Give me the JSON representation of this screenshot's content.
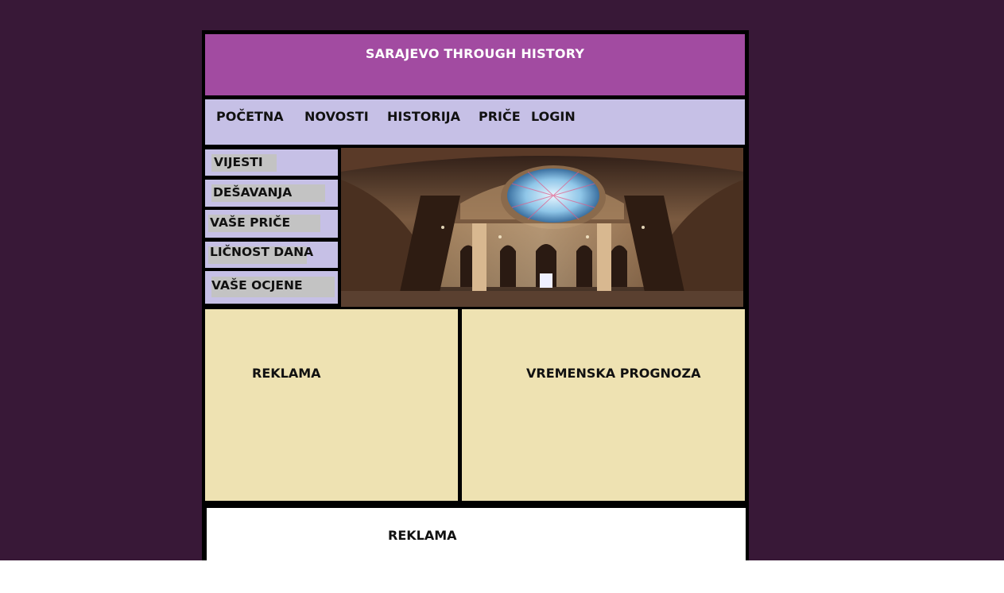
{
  "header": {
    "title": "SARAJEVO THROUGH HISTORY"
  },
  "nav": {
    "items": [
      {
        "label": "POČETNA"
      },
      {
        "label": "NOVOSTI"
      },
      {
        "label": "HISTORIJA"
      },
      {
        "label": "PRIČE"
      },
      {
        "label": "LOGIN"
      }
    ]
  },
  "sidebar": {
    "items": [
      {
        "label": "VIJESTI"
      },
      {
        "label": "DEŠAVANJA"
      },
      {
        "label": "VAŠE PRIČE"
      },
      {
        "label": "LIČNOST DANA"
      },
      {
        "label": "VAŠE OCJENE"
      }
    ]
  },
  "hero": {
    "image": "vijecnica-interior-photo"
  },
  "panels": {
    "left": {
      "label": "REKLAMA"
    },
    "right": {
      "label": "VREMENSKA PROGNOZA"
    }
  },
  "footer": {
    "label": "REKLAMA"
  },
  "colors": {
    "page_background": "#381837",
    "header": "#a24ba1",
    "nav": "#c6c0e6",
    "panel": "#eee2b2",
    "border": "#000000"
  }
}
